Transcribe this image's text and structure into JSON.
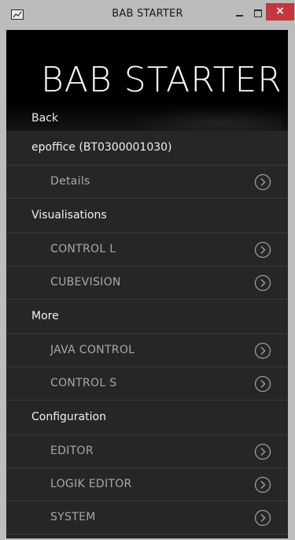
{
  "window": {
    "title": "BAB STARTER",
    "close_glyph": "×",
    "icon": "app-icon"
  },
  "header": {
    "title": "BAB STARTER",
    "back_label": "Back"
  },
  "menu": {
    "device": {
      "label": "epoffice (BT0300001030)"
    },
    "details": {
      "label": "Details",
      "icon": "chevron-right-circle-icon"
    },
    "visualisations": {
      "label": "Visualisations",
      "items": [
        {
          "label": "CONTROL L",
          "icon": "chevron-right-circle-icon"
        },
        {
          "label": "CUBEVISION",
          "icon": "chevron-right-circle-icon"
        }
      ]
    },
    "more": {
      "label": "More",
      "items": [
        {
          "label": "JAVA CONTROL",
          "icon": "chevron-right-circle-icon"
        },
        {
          "label": "CONTROL S",
          "icon": "chevron-right-circle-icon"
        }
      ]
    },
    "configuration": {
      "label": "Configuration",
      "items": [
        {
          "label": "EDITOR",
          "icon": "chevron-right-circle-icon"
        },
        {
          "label": "LOGIK EDITOR",
          "icon": "chevron-right-circle-icon"
        },
        {
          "label": "SYSTEM",
          "icon": "chevron-right-circle-icon"
        }
      ]
    }
  },
  "colors": {
    "background": "#262626",
    "header_bg": "#000000",
    "section_text": "#f0f0f0",
    "item_text": "#a8a8a8",
    "divider": "#3a3a3a",
    "close_button": "#c7353d",
    "titlebar": "#bcbcbc"
  }
}
